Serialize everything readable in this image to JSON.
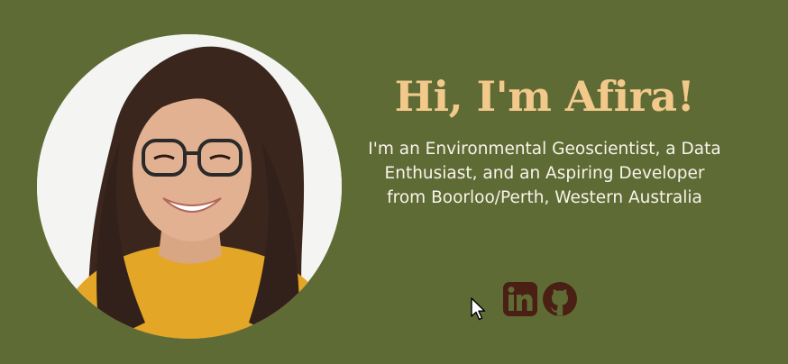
{
  "hero": {
    "title": "Hi, I'm Afira!",
    "bio": "I'm an Environmental Geoscientist, a Data Enthusiast, and an Aspiring Developer from Boorloo/Perth, Western Australia",
    "portrait_icon": "profile-photo"
  },
  "social": {
    "items": [
      {
        "icon": "linkedin-icon",
        "label": "LinkedIn"
      },
      {
        "icon": "github-icon",
        "label": "GitHub"
      }
    ]
  },
  "colors": {
    "background": "#5f6b35",
    "title": "#f2c98b",
    "bio_text": "#f7f3ea",
    "social_icons": "#4a1f14",
    "portrait_bg": "#f4f4f2"
  }
}
